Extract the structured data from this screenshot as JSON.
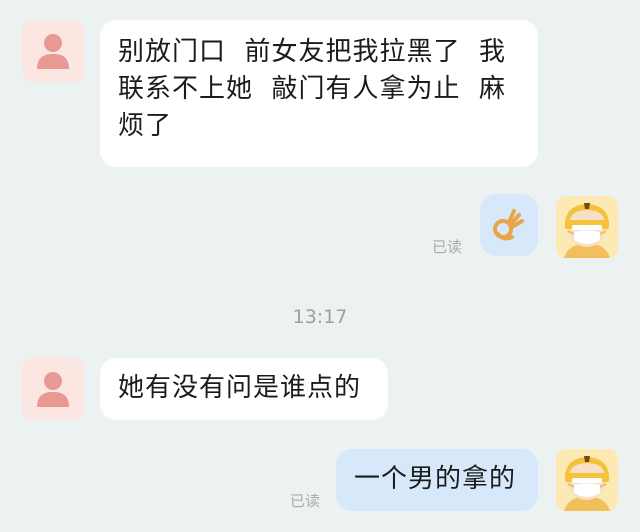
{
  "messages": [
    {
      "side": "left",
      "text": "别放门口  前女友把我拉黑了  我联系不上她  敲门有人拿为止  麻烦了"
    },
    {
      "side": "right",
      "emoji": "ok-hand",
      "read_label": "已读"
    },
    {
      "timestamp": "13:17"
    },
    {
      "side": "left",
      "text": "她有没有问是谁点的"
    },
    {
      "side": "right",
      "text": "一个男的拿的",
      "read_label": "已读"
    }
  ],
  "avatars": {
    "left": "person-avatar-icon",
    "right": "masked-helmet-avatar"
  },
  "colors": {
    "background": "#ecf1f1",
    "incoming_bubble": "#ffffff",
    "outgoing_bubble": "#d7e8fb",
    "left_avatar_bg": "#fbe6e1",
    "left_avatar_figure": "#e89994",
    "right_avatar_bg": "#fde9b4",
    "helmet": "#f5c23c"
  }
}
